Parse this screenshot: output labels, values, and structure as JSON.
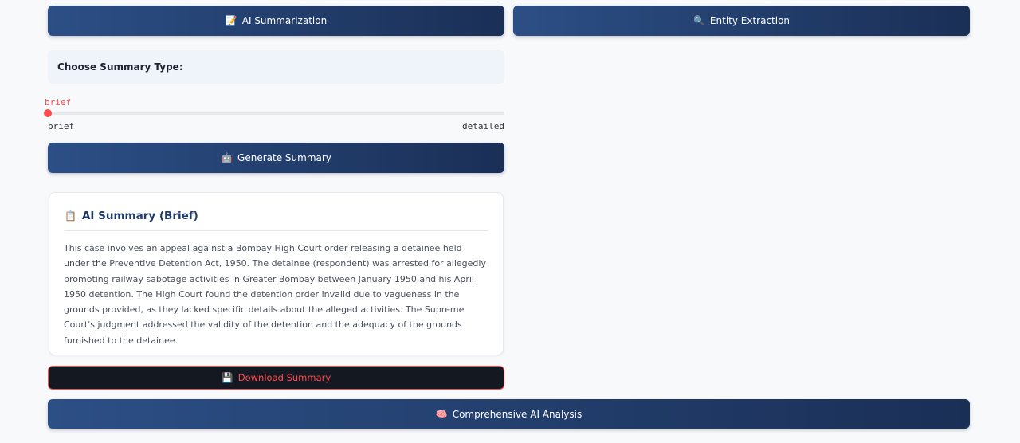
{
  "tabs": {
    "summarization": {
      "icon": "📝",
      "label": "AI Summarization"
    },
    "entity": {
      "icon": "🔍",
      "label": "Entity Extraction"
    }
  },
  "summary_type": {
    "label": "Choose Summary Type:"
  },
  "slider": {
    "value": "brief",
    "min_label": "brief",
    "max_label": "detailed",
    "level": 0
  },
  "generate": {
    "icon": "🤖",
    "label": "Generate Summary"
  },
  "summary_card": {
    "icon": "📋",
    "title": "AI Summary (Brief)",
    "text": "This case involves an appeal against a Bombay High Court order releasing a detainee held under the Preventive Detention Act, 1950. The detainee (respondent) was arrested for allegedly promoting railway sabotage activities in Greater Bombay between January 1950 and his April 1950 detention. The High Court found the detention order invalid due to vagueness in the grounds provided, as they lacked specific details about the alleged activities. The Supreme Court's judgment addressed the validity of the detention and the adequacy of the grounds furnished to the detainee."
  },
  "download": {
    "icon": "💾",
    "label": "Download Summary"
  },
  "analysis": {
    "icon": "🧠",
    "label": "Comprehensive AI Analysis"
  },
  "colors": {
    "accent": "#ff4b4b",
    "primary_dark": "#1a2f56",
    "primary": "#2c4f86"
  }
}
